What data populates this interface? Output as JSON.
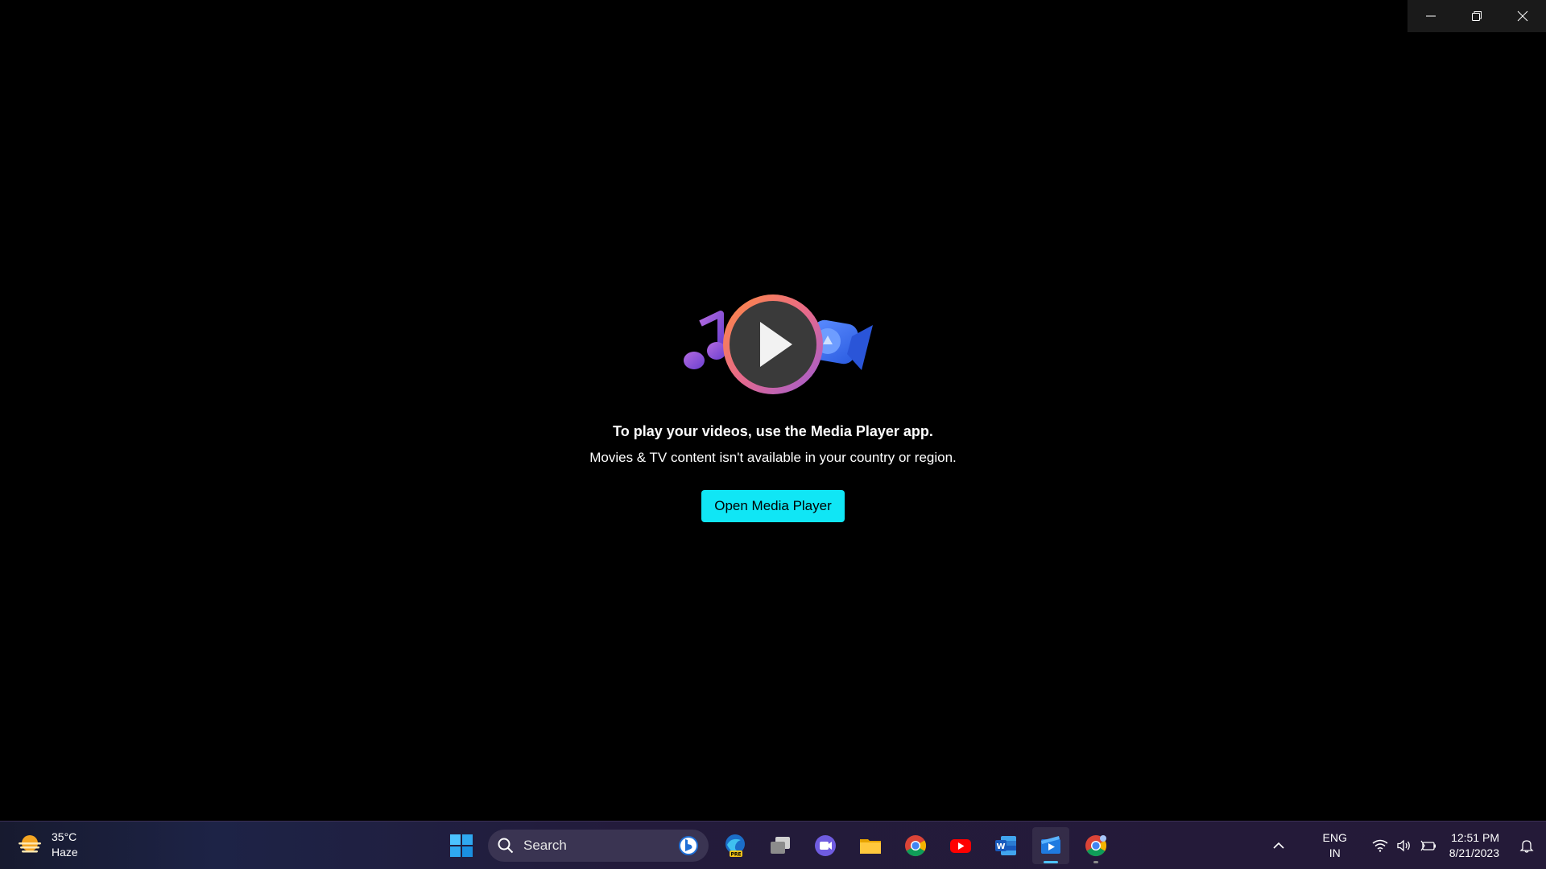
{
  "window": {
    "caption_buttons": [
      "minimize",
      "restore",
      "close"
    ]
  },
  "main": {
    "title": "To play your videos, use the Media Player app.",
    "subtitle": "Movies & TV content isn't available in your country or region.",
    "open_button_label": "Open Media Player",
    "accent_color": "#10e6f5"
  },
  "taskbar": {
    "weather": {
      "temperature": "35°C",
      "condition": "Haze",
      "icon": "haze-sun-icon"
    },
    "search": {
      "placeholder": "Search"
    },
    "pinned_apps": [
      {
        "name": "start",
        "icon": "windows-start-icon"
      },
      {
        "name": "edge-beta",
        "icon": "edge-pre-icon",
        "badge": "PRE"
      },
      {
        "name": "task-view",
        "icon": "task-view-icon"
      },
      {
        "name": "meet",
        "icon": "video-chat-icon"
      },
      {
        "name": "file-explorer",
        "icon": "folder-icon"
      },
      {
        "name": "chrome",
        "icon": "chrome-icon"
      },
      {
        "name": "youtube",
        "icon": "youtube-icon"
      },
      {
        "name": "word",
        "icon": "word-icon"
      },
      {
        "name": "movies-tv",
        "icon": "movies-tv-icon",
        "active": true
      },
      {
        "name": "chrome-canary",
        "icon": "chrome-canary-icon",
        "running": true
      }
    ],
    "tray": {
      "language_line1": "ENG",
      "language_line2": "IN",
      "time": "12:51 PM",
      "date": "8/21/2023"
    }
  }
}
